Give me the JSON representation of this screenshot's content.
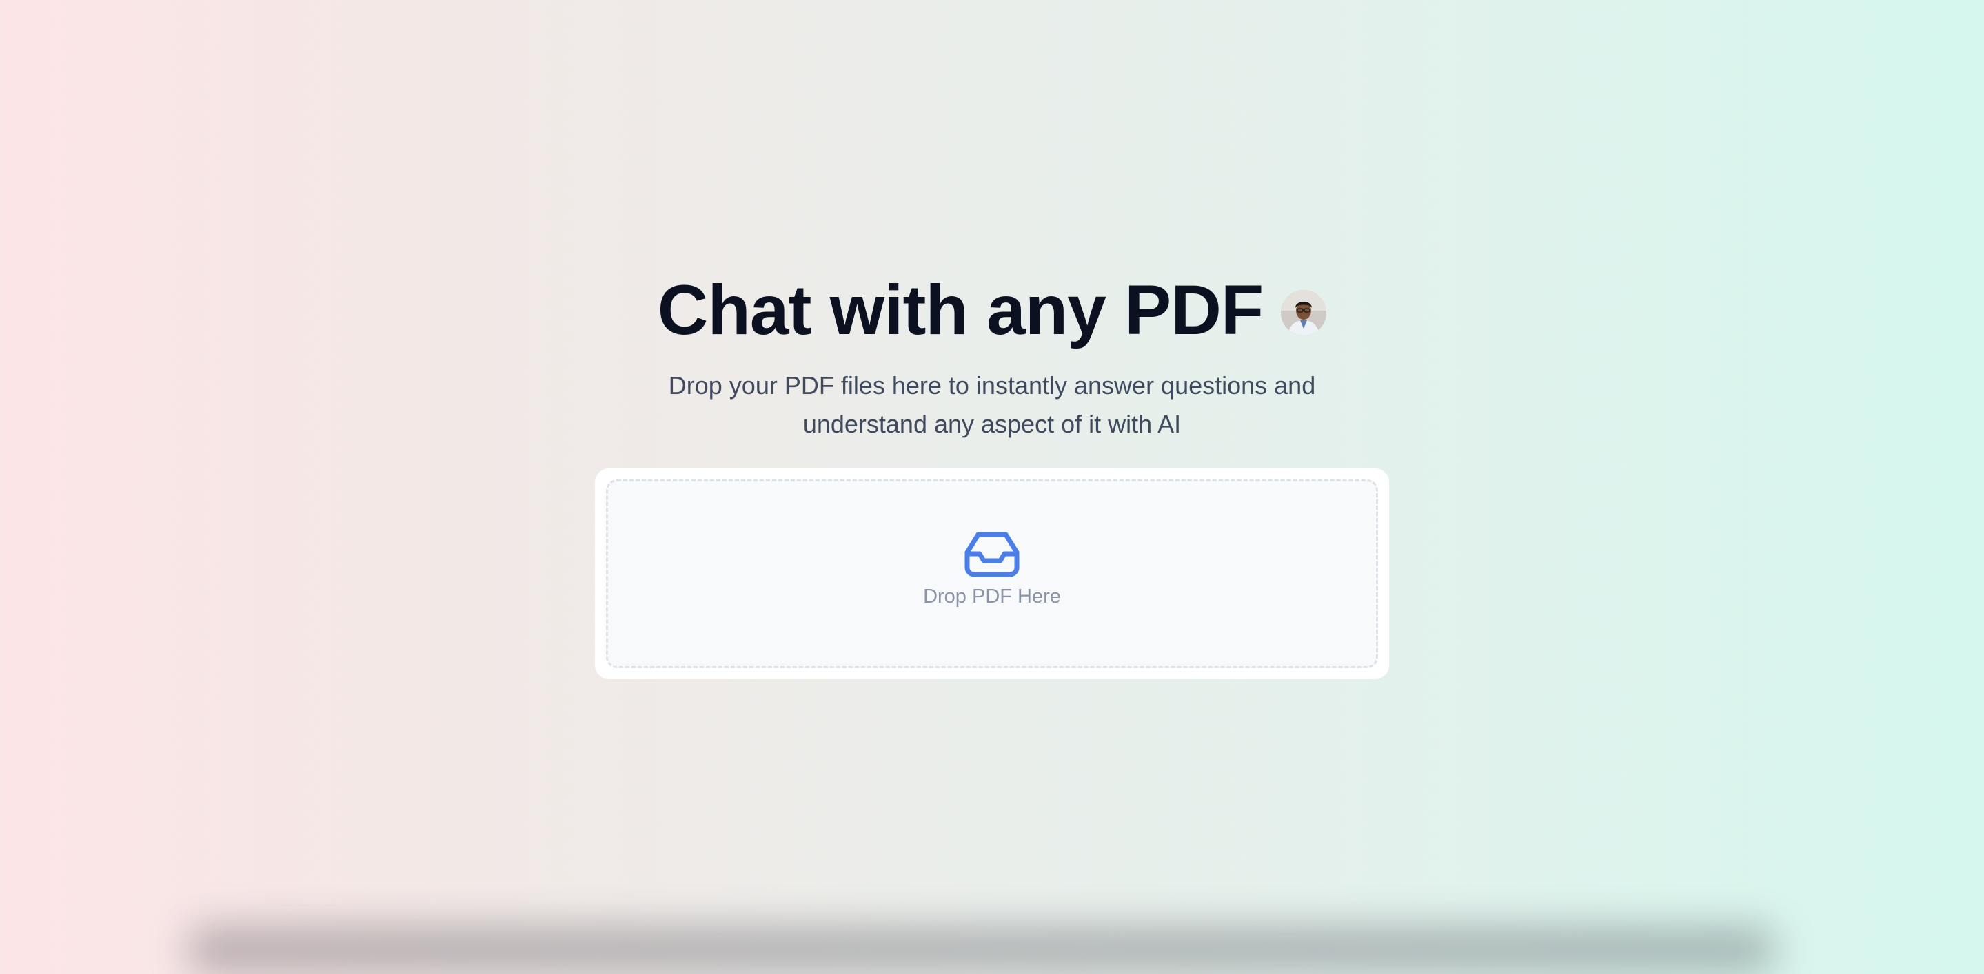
{
  "hero": {
    "title": "Chat with any PDF",
    "subtitle_line1": "Drop your PDF files here to instantly answer questions and",
    "subtitle_line2": "understand any aspect of it with AI"
  },
  "upload": {
    "label": "Drop PDF Here",
    "icon": "inbox-icon",
    "icon_color": "#4b7ee8"
  },
  "colors": {
    "background_left": "#fde5e7",
    "background_right": "#d5f7ee",
    "title": "#0b1120",
    "subtitle": "#3f4a5e"
  }
}
